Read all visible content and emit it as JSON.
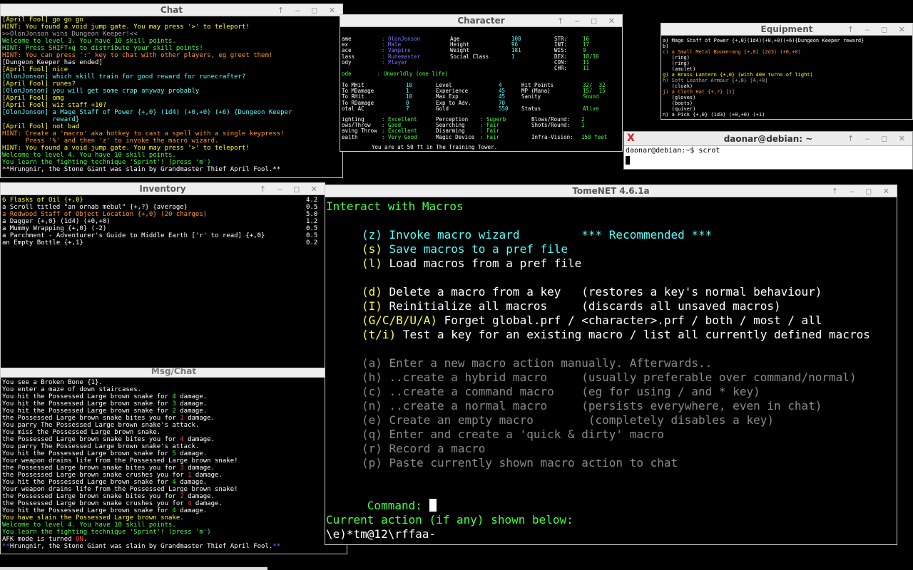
{
  "windows": {
    "chat": {
      "title": "Chat",
      "lines": [
        {
          "t": "[April Fool] go go go",
          "c": "y"
        },
        {
          "t": "HINT: You found a void jump gate. You may press '>' to teleport!",
          "c": "y"
        },
        {
          "t": ">>OlonJonson wins Dungeon Keeper!<<",
          "c": "gy"
        },
        {
          "t": "Welcome to level 3. You have 10 skill points.",
          "c": "g"
        },
        {
          "t": "HINT: Press SHIFT+g to distribute your skill points!",
          "c": "g"
        },
        {
          "t": "HINT: You can press ':' key to chat with other players, eg greet them!",
          "c": "o"
        },
        {
          "t": "[Dungeon Keeper has ended]",
          "c": "w"
        },
        {
          "t": "[April Fool] nice",
          "c": "y"
        },
        {
          "t": "[OlonJonson] which skill train for good reward for runecrafter?",
          "c": "c"
        },
        {
          "t": "[April Fool] runes?",
          "c": "y"
        },
        {
          "t": "[OlonJonson] you will get some crap anyway probably",
          "c": "c"
        },
        {
          "t": "[April Fool] omg",
          "c": "y"
        },
        {
          "t": "[April Fool] wiz staff +10?",
          "c": "y"
        },
        {
          "t": "[OlonJonson] a Mage Staff of Power {+,0} (1d4) (+0,+0) (+6) {Dungeon Keeper",
          "c": "c"
        },
        {
          "t": "             reward}",
          "c": "c"
        },
        {
          "t": "[April Fool] not bad",
          "c": "y"
        },
        {
          "t": "HINT: Create a 'macro' aka hotkey to cast a spell with a single keypress!",
          "c": "o"
        },
        {
          "t": "      Press '%' and then 'z' to invoke the macro wizard.",
          "c": "o"
        },
        {
          "t": "HINT: You found a void jump gate. You may press '>' to teleport!",
          "c": "y"
        },
        {
          "t": "Welcome to level 4. You have 10 skill points.",
          "c": "g"
        },
        {
          "t": "You learn the fighting technique 'Sprint'! (press 'm')",
          "c": "g"
        },
        {
          "t": "**Hrungnir, the Stone Giant was slain by Grandmaster Thief April Fool.**",
          "c": "w"
        }
      ]
    },
    "character": {
      "title": "Character",
      "col1": [
        {
          "l": "ame",
          "v": ": OlonJonson",
          "vc": "b"
        },
        {
          "l": "ex",
          "v": ": Male",
          "vc": "b"
        },
        {
          "l": "ace",
          "v": ": Vampire",
          "vc": "b"
        },
        {
          "l": "lass",
          "v": ": Runemaster",
          "vc": "b"
        },
        {
          "l": "ody",
          "v": ": Player",
          "vc": "b"
        }
      ],
      "col2": [
        {
          "l": "Age",
          "v": "108"
        },
        {
          "l": "Height",
          "v": "96"
        },
        {
          "l": "Weight",
          "v": "181"
        },
        {
          "l": "Social Class",
          "v": "1"
        }
      ],
      "stats": [
        {
          "l": "STR:",
          "v": "16"
        },
        {
          "l": "INT:",
          "v": "17"
        },
        {
          "l": "WIS:",
          "v": "9"
        },
        {
          "l": "DEX:",
          "v": "18/30"
        },
        {
          "l": "CON:",
          "v": "11"
        },
        {
          "l": "CHR:",
          "v": "11"
        }
      ],
      "mode": "ode        : Unworldly (one life)",
      "combat": [
        {
          "l": "To MHit",
          "v": "10"
        },
        {
          "l": "To MDamage",
          "v": "1"
        },
        {
          "l": "To RHit",
          "v": "10"
        },
        {
          "l": "To RDamage",
          "v": "0"
        },
        {
          "l": "otal AC",
          "v": "7"
        }
      ],
      "progress": [
        {
          "l": "Level",
          "v": "4"
        },
        {
          "l": "Experience",
          "v": "45"
        },
        {
          "l": "Max Exp",
          "v": "45"
        },
        {
          "l": "Exp to Adv.",
          "v": "70"
        },
        {
          "l": "Gold",
          "v": "550"
        }
      ],
      "vitals": [
        {
          "l": "Hit Points",
          "v": "32/  32"
        },
        {
          "l": "MP (Mana)",
          "v": "15/  15"
        },
        {
          "l": "Sanity",
          "v": "Sound"
        },
        {
          "l": "",
          "v": ""
        },
        {
          "l": "Status",
          "v": "Alive"
        }
      ],
      "skills1": [
        {
          "l": "ighting",
          "v": ": Excellent"
        },
        {
          "l": "ows/Throw",
          "v": ": Good"
        },
        {
          "l": "aving Throw",
          "v": ": Excellent"
        },
        {
          "l": "ealth",
          "v": ": Very Good"
        }
      ],
      "skills2": [
        {
          "l": "Perception",
          "v": ": Superb"
        },
        {
          "l": "Searching",
          "v": ": Fair"
        },
        {
          "l": "Disarming",
          "v": ": Fair"
        },
        {
          "l": "Magic Device",
          "v": ": Fair"
        }
      ],
      "skills3": [
        {
          "l": "Blows/Round:",
          "v": "2"
        },
        {
          "l": "Shots/Round:",
          "v": "1"
        },
        {
          "l": "",
          "v": ""
        },
        {
          "l": "Infra-Vision:",
          "v": "150 feet"
        }
      ],
      "location": "You are at 50 ft in The Training Tower."
    },
    "equipment": {
      "title": "Equipment",
      "lines": [
        {
          "t": "a) Mage Staff of Power {+,0}(1d4)(+0,+0)(+6){Dungeon Keeper reward}",
          "c": "w"
        },
        {
          "t": "b)",
          "c": "w"
        },
        {
          "t": "c) a Small Metal Boomerang {+,0} (2d3) (+0,+0)",
          "c": "o"
        },
        {
          "t": "   (ring)",
          "c": "w"
        },
        {
          "t": "   (ring)",
          "c": "w"
        },
        {
          "t": "   (amulet)",
          "c": "w"
        },
        {
          "t": "g) a Brass Lantern {+,0} (with 400 turns of light)",
          "c": "y"
        },
        {
          "t": "h) Soft Leather Armour {+,0} [4,+0]",
          "c": "gy"
        },
        {
          "t": "   (cloak)",
          "c": "w"
        },
        {
          "t": "j) a Cloth Hat {+,?} [1]",
          "c": "o"
        },
        {
          "t": "   (gloves)",
          "c": "w"
        },
        {
          "t": "   (boots)",
          "c": "w"
        },
        {
          "t": "   (quiver)",
          "c": "w"
        },
        {
          "t": "n) a Pick {+,0} (1d3) (+0,+0) (+1)",
          "c": "w"
        }
      ]
    },
    "xterm": {
      "title": "daonar@debian: ~",
      "prompt": "daonar@debian:~$ scrot"
    },
    "inventory": {
      "title": "Inventory",
      "items": [
        {
          "t": "6 Flasks of Oil {+,0}",
          "w": "4.2",
          "c": "y"
        },
        {
          "t": "a Scroll titled \"an ornab mebul\" {+,?} {average}",
          "w": "0.5",
          "c": "w"
        },
        {
          "t": "a Redwood Staff of Object Location {+,0} (20 charges)",
          "w": "5.0",
          "c": "o"
        },
        {
          "t": "a Dagger {+,0} (1d4) (+0,+0)",
          "w": "1.2",
          "c": "w"
        },
        {
          "t": "a Mummy Wrapping {+,0} (-2)",
          "w": "0.5",
          "c": "w"
        },
        {
          "t": "a Parchment - Adventurer's Guide to Middle Earth ['r' to read] {+,0}",
          "w": "0.5",
          "c": "w"
        },
        {
          "t": "an Empty Bottle {+,1}",
          "w": "0.2",
          "c": "w"
        }
      ]
    },
    "msg": {
      "title": "Msg/Chat",
      "lines": [
        {
          "p": [
            {
              "t": "You see a Broken Bone {1}.",
              "c": "w"
            }
          ]
        },
        {
          "p": [
            {
              "t": "You enter a maze of down staircases.",
              "c": "w"
            }
          ]
        },
        {
          "p": [
            {
              "t": "You hit the Possessed Large brown snake for ",
              "c": "w"
            },
            {
              "t": "4",
              "c": "g"
            },
            {
              "t": " damage.",
              "c": "w"
            }
          ]
        },
        {
          "p": [
            {
              "t": "You hit the Possessed Large brown snake for ",
              "c": "w"
            },
            {
              "t": "3",
              "c": "g"
            },
            {
              "t": " damage.",
              "c": "w"
            }
          ]
        },
        {
          "p": [
            {
              "t": "You hit the Possessed Large brown snake for ",
              "c": "w"
            },
            {
              "t": "2",
              "c": "g"
            },
            {
              "t": " damage.",
              "c": "w"
            }
          ]
        },
        {
          "p": [
            {
              "t": "the Possessed Large brown snake bites you for ",
              "c": "w"
            },
            {
              "t": "1",
              "c": "r"
            },
            {
              "t": " damage.",
              "c": "w"
            }
          ]
        },
        {
          "p": [
            {
              "t": "You parry The Possessed Large brown snake's attack.",
              "c": "w"
            }
          ]
        },
        {
          "p": [
            {
              "t": "You miss the Possessed Large brown snake.",
              "c": "w"
            }
          ]
        },
        {
          "p": [
            {
              "t": "the Possessed Large brown snake bites you for ",
              "c": "w"
            },
            {
              "t": "4",
              "c": "r"
            },
            {
              "t": " damage.",
              "c": "w"
            }
          ]
        },
        {
          "p": [
            {
              "t": "You parry The Possessed Large brown snake's attack.",
              "c": "w"
            }
          ]
        },
        {
          "p": [
            {
              "t": "You hit the Possessed Large brown snake for ",
              "c": "w"
            },
            {
              "t": "5",
              "c": "g"
            },
            {
              "t": " damage.",
              "c": "w"
            }
          ]
        },
        {
          "p": [
            {
              "t": "Your weapon drains life from the Possessed Large brown snake!",
              "c": "w"
            }
          ]
        },
        {
          "p": [
            {
              "t": "the Possessed Large brown snake bites you for ",
              "c": "w"
            },
            {
              "t": "3",
              "c": "r"
            },
            {
              "t": " damage.",
              "c": "w"
            }
          ]
        },
        {
          "p": [
            {
              "t": "the Possessed Large brown snake crushes you for ",
              "c": "w"
            },
            {
              "t": "1",
              "c": "r"
            },
            {
              "t": " damage.",
              "c": "w"
            }
          ]
        },
        {
          "p": [
            {
              "t": "You hit the Possessed Large brown snake for ",
              "c": "w"
            },
            {
              "t": "4",
              "c": "g"
            },
            {
              "t": " damage.",
              "c": "w"
            }
          ]
        },
        {
          "p": [
            {
              "t": "Your weapon drains life from the Possessed Large brown snake!",
              "c": "w"
            }
          ]
        },
        {
          "p": [
            {
              "t": "the Possessed Large brown snake bites you for ",
              "c": "w"
            },
            {
              "t": "2",
              "c": "r"
            },
            {
              "t": " damage.",
              "c": "w"
            }
          ]
        },
        {
          "p": [
            {
              "t": "the Possessed Large brown snake crushes you for ",
              "c": "w"
            },
            {
              "t": "4",
              "c": "r"
            },
            {
              "t": " damage.",
              "c": "w"
            }
          ]
        },
        {
          "p": [
            {
              "t": "You hit the Possessed Large brown snake for ",
              "c": "w"
            },
            {
              "t": "4",
              "c": "g"
            },
            {
              "t": " damage.",
              "c": "w"
            }
          ]
        },
        {
          "p": [
            {
              "t": "You have slain the Possessed Large brown snake.",
              "c": "y"
            }
          ]
        },
        {
          "p": [
            {
              "t": "Welcome to level 4. You have 10 skill points.",
              "c": "g"
            }
          ]
        },
        {
          "p": [
            {
              "t": "You learn the fighting technique 'Sprint'! (press 'm')",
              "c": "g"
            }
          ]
        },
        {
          "p": [
            {
              "t": "AFK mode is turned ",
              "c": "w"
            },
            {
              "t": "ON",
              "c": "r"
            },
            {
              "t": ".",
              "c": "w"
            }
          ]
        },
        {
          "p": [
            {
              "t": "**",
              "c": "b"
            },
            {
              "t": "Hrungnir, the Stone Giant was slain by Grandmaster Thief April Fool.",
              "c": "w"
            },
            {
              "t": "**",
              "c": "b"
            }
          ]
        }
      ]
    },
    "main": {
      "title": "TomeNET 4.6.1a",
      "heading": "Interact with Macros",
      "options": [
        {
          "key": "(z)",
          "label": " Invoke macro wizard",
          "note": "         *** Recommended ***",
          "kc": "c",
          "lc": "c",
          "nc": "c"
        },
        {
          "key": "(s)",
          "label": " Save macros to a pref file",
          "note": "",
          "kc": "y",
          "lc": "c",
          "nc": "w"
        },
        {
          "key": "(l)",
          "label": " Load macros from a pref file",
          "note": "",
          "kc": "y",
          "lc": "w",
          "nc": "w"
        },
        {
          "key": "",
          "label": "",
          "note": "",
          "kc": "w",
          "lc": "w",
          "nc": "w"
        },
        {
          "key": "(d)",
          "label": " Delete a macro from a key",
          "note": "   (restores a key's normal behaviour)",
          "kc": "y",
          "lc": "w",
          "nc": "w"
        },
        {
          "key": "(I)",
          "label": " Reinitialize all macros",
          "note": "     (discards all unsaved macros)",
          "kc": "y",
          "lc": "w",
          "nc": "w"
        },
        {
          "key": "(G/C/B/U/A)",
          "label": " Forget global.prf / <character>.prf / both / most / all",
          "note": "",
          "kc": "y",
          "lc": "w",
          "nc": "w"
        },
        {
          "key": "(t/i)",
          "label": " Test a key for an existing macro / list all currently defined macros",
          "note": "",
          "kc": "y",
          "lc": "w",
          "nc": "w"
        },
        {
          "key": "",
          "label": "",
          "note": "",
          "kc": "w",
          "lc": "w",
          "nc": "w"
        },
        {
          "key": "(a)",
          "label": " Enter a new macro action manually. Afterwards..",
          "note": "",
          "kc": "dg",
          "lc": "dg",
          "nc": "dg"
        },
        {
          "key": "(h)",
          "label": " ..create a hybrid macro",
          "note": "     (usually preferable over command/normal)",
          "kc": "dg",
          "lc": "dg",
          "nc": "dg"
        },
        {
          "key": "(c)",
          "label": " ..create a command macro",
          "note": "    (eg for using / and * key)",
          "kc": "dg",
          "lc": "dg",
          "nc": "dg"
        },
        {
          "key": "(n)",
          "label": " ..create a normal macro",
          "note": "     (persists everywhere, even in chat)",
          "kc": "dg",
          "lc": "dg",
          "nc": "dg"
        },
        {
          "key": "(e)",
          "label": " Create an empty macro",
          "note": "        (completely disables a key)",
          "kc": "dg",
          "lc": "dg",
          "nc": "dg"
        },
        {
          "key": "(q)",
          "label": " Enter and create a 'quick & dirty' macro",
          "note": "",
          "kc": "dg",
          "lc": "dg",
          "nc": "dg"
        },
        {
          "key": "(r)",
          "label": " Record a macro",
          "note": "",
          "kc": "dg",
          "lc": "dg",
          "nc": "dg"
        },
        {
          "key": "(p)",
          "label": " Paste currently shown macro action to chat",
          "note": "",
          "kc": "dg",
          "lc": "dg",
          "nc": "dg"
        }
      ],
      "command_label": "Command: ",
      "current_label": "Current action (if any) shown below:",
      "current_value": "\\e)*tm@12\\rffaa-"
    }
  },
  "colors": {
    "white": "#ffffff",
    "yellow": "#ffff33",
    "green": "#44ff44",
    "cyan": "#55ffff",
    "orange": "#ff9a2e",
    "grey": "#a8a8a8",
    "red": "#ff4444",
    "blue": "#7878ff"
  },
  "controls": "↑ ‒ ◻ ✕"
}
